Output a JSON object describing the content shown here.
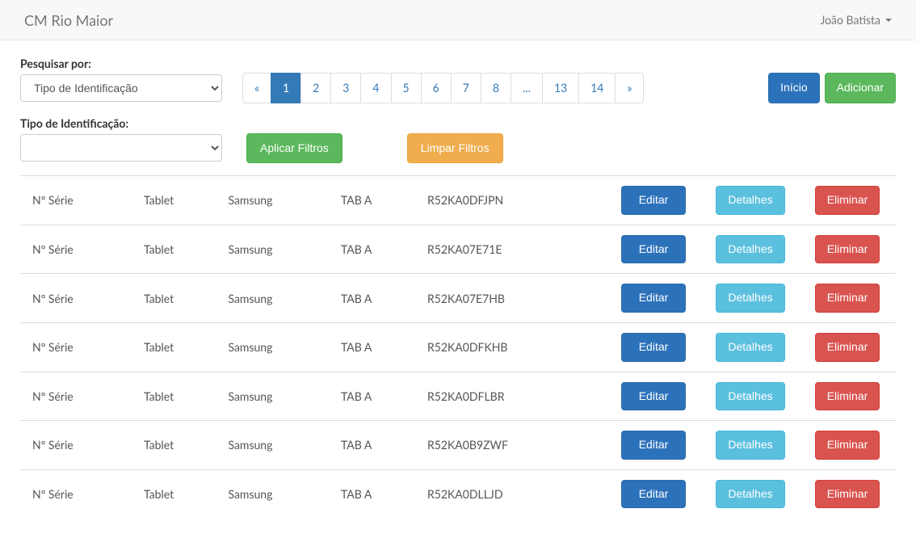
{
  "navbar": {
    "brand": "CM Rio Maior",
    "user": "João Batista"
  },
  "filters": {
    "search_label": "Pesquisar por:",
    "search_selected": "Tipo de Identificação",
    "type_label": "Tipo de Identificação:",
    "type_selected": "",
    "apply_label": "Aplicar Filtros",
    "clear_label": "Limpar Filtros"
  },
  "pagination": {
    "prev": "«",
    "next": "»",
    "pages": [
      "1",
      "2",
      "3",
      "4",
      "5",
      "6",
      "7",
      "8",
      "...",
      "13",
      "14"
    ],
    "active": "1"
  },
  "top_actions": {
    "home_label": "Início",
    "add_label": "Adicionar"
  },
  "table": {
    "edit_label": "Editar",
    "details_label": "Detalhes",
    "delete_label": "Eliminar",
    "rows": [
      {
        "col1": "Nº Série",
        "col2": "Tablet",
        "col3": "Samsung",
        "col4": "TAB A",
        "col5": "R52KA0DFJPN"
      },
      {
        "col1": "Nº Série",
        "col2": "Tablet",
        "col3": "Samsung",
        "col4": "TAB A",
        "col5": "R52KA07E71E"
      },
      {
        "col1": "Nº Série",
        "col2": "Tablet",
        "col3": "Samsung",
        "col4": "TAB A",
        "col5": "R52KA07E7HB"
      },
      {
        "col1": "Nº Série",
        "col2": "Tablet",
        "col3": "Samsung",
        "col4": "TAB A",
        "col5": "R52KA0DFKHB"
      },
      {
        "col1": "Nº Série",
        "col2": "Tablet",
        "col3": "Samsung",
        "col4": "TAB A",
        "col5": "R52KA0DFLBR"
      },
      {
        "col1": "Nº Série",
        "col2": "Tablet",
        "col3": "Samsung",
        "col4": "TAB A",
        "col5": "R52KA0B9ZWF"
      },
      {
        "col1": "Nº Série",
        "col2": "Tablet",
        "col3": "Samsung",
        "col4": "TAB A",
        "col5": "R52KA0DLLJD"
      }
    ]
  }
}
